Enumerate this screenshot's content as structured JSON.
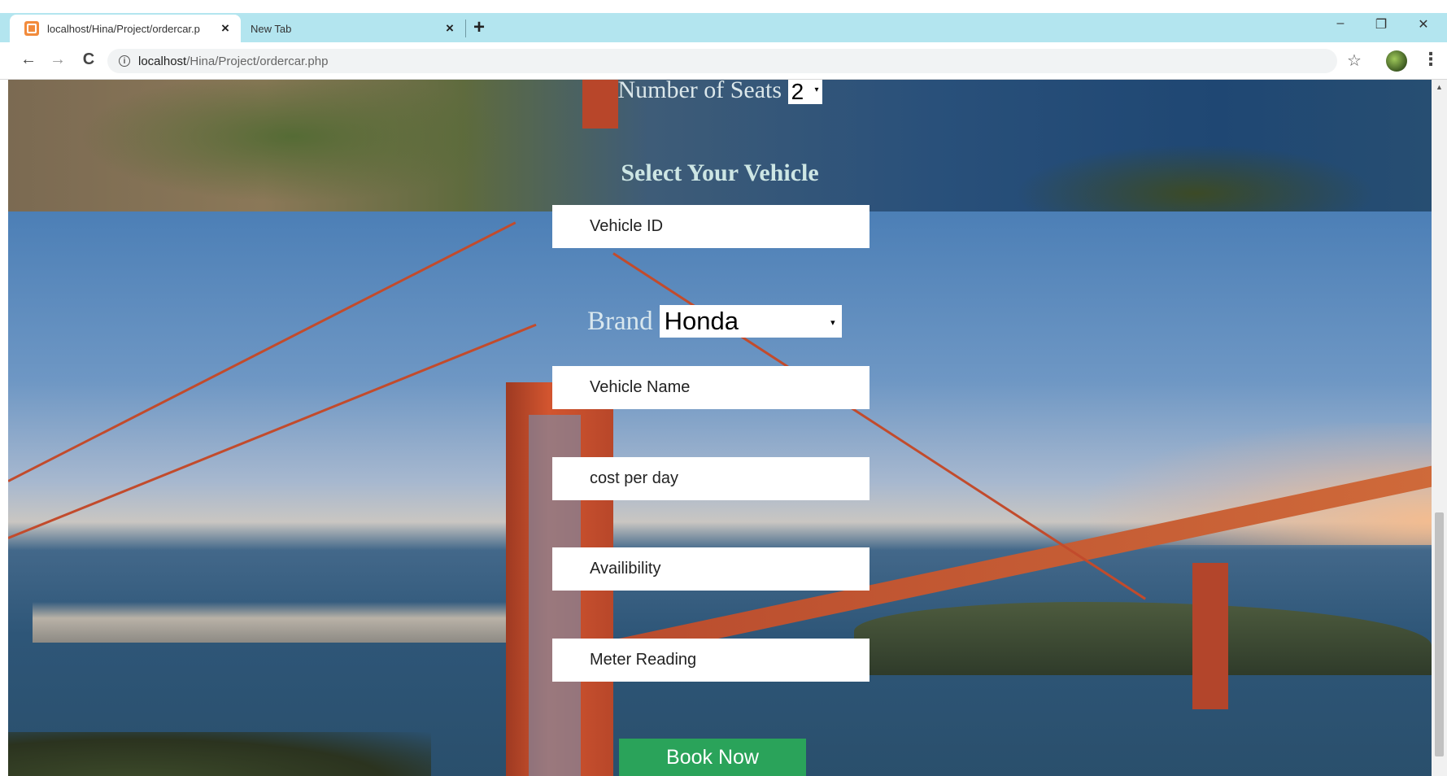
{
  "browser": {
    "tabs": [
      {
        "title": "localhost/Hina/Project/ordercar.p",
        "close": "×"
      },
      {
        "title": "New Tab",
        "close": "×"
      }
    ],
    "new_tab": "+",
    "window_controls": {
      "minimize": "–",
      "maximize": "❐",
      "close": "✕"
    },
    "url_host": "localhost",
    "url_path": "/Hina/Project/ordercar.php",
    "nav": {
      "back": "←",
      "forward": "→",
      "reload": "C"
    },
    "star": "☆",
    "menu": "⋮"
  },
  "form": {
    "seats_label": "Number of Seats",
    "seats_value": "2",
    "heading": "Select Your Vehicle",
    "vehicle_id_placeholder": "Vehicle ID",
    "brand_label": "Brand",
    "brand_value": "Honda",
    "vehicle_name_placeholder": "Vehicle Name",
    "cost_placeholder": "cost per day",
    "availability_placeholder": "Availibility",
    "meter_placeholder": "Meter Reading",
    "submit_label": "Book Now"
  },
  "colors": {
    "tab_bar": "#b3e5ef",
    "submit_bg": "#2aa35a"
  }
}
